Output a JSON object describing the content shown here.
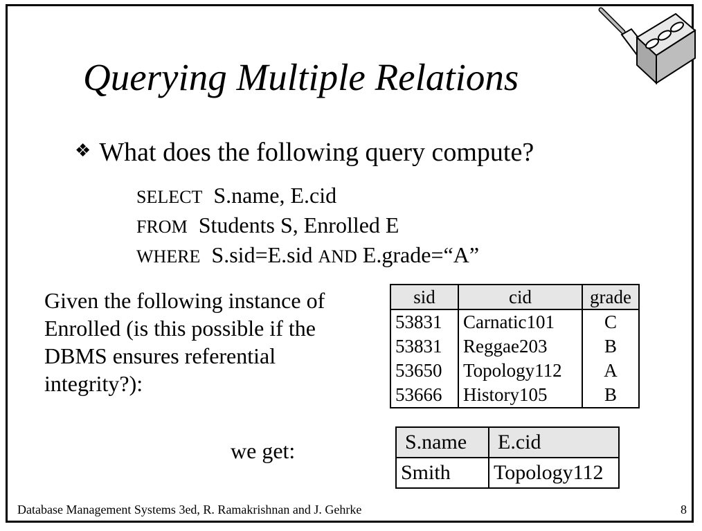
{
  "slide": {
    "title": "Querying Multiple Relations",
    "bullet": "What does the following query compute?",
    "sql": {
      "line1_kw": "SELECT",
      "line1_rest": "S.name, E.cid",
      "line2_kw": "FROM",
      "line2_rest": "Students S, Enrolled E",
      "line3_kw": "WHERE",
      "line3_part1": "S.sid=E.sid",
      "line3_kw2": "AND",
      "line3_part2": "E.grade=“A”"
    },
    "given_text": "Given the following instance of Enrolled (is this possible if the DBMS ensures referential integrity?):",
    "we_get": "we get:",
    "footer": "Database Management Systems 3ed,  R. Ramakrishnan and J. Gehrke",
    "page_number": "8"
  },
  "enrolled_table": {
    "headers": [
      "sid",
      "cid",
      "grade"
    ],
    "rows": [
      [
        "53831",
        "Carnatic101",
        "C"
      ],
      [
        "53831",
        "Reggae203",
        "B"
      ],
      [
        "53650",
        "Topology112",
        "A"
      ],
      [
        "53666",
        "History105",
        "B"
      ]
    ]
  },
  "result_table": {
    "headers": [
      "S.name",
      "E.cid"
    ],
    "rows": [
      [
        "Smith",
        "Topology112"
      ]
    ]
  },
  "icons": {
    "bullet": "diamond-bullet-icon",
    "logo": "database-brick-trowel-logo"
  }
}
